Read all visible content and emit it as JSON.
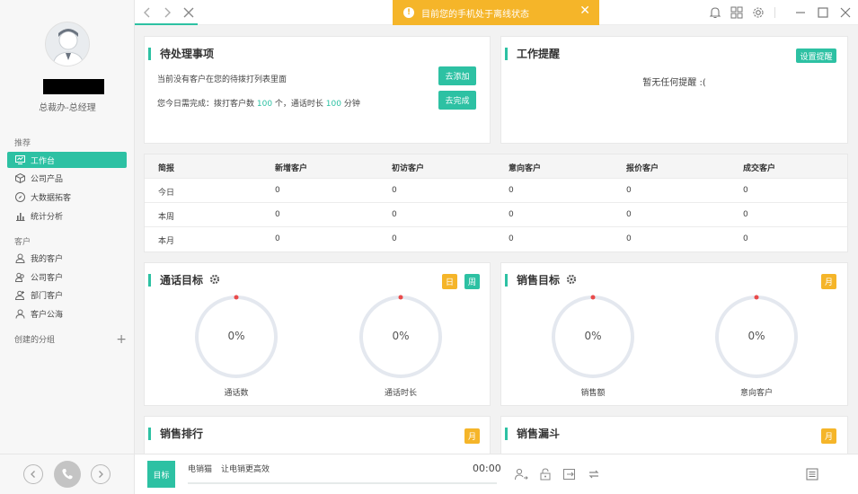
{
  "user": {
    "role": "总裁办-总经理"
  },
  "sidebar": {
    "section_recommend": "推荐",
    "recommend_items": [
      {
        "label": "工作台",
        "icon": "monitor-icon",
        "active": true
      },
      {
        "label": "公司产品",
        "icon": "box-icon"
      },
      {
        "label": "大数据拓客",
        "icon": "compass-icon"
      },
      {
        "label": "统计分析",
        "icon": "bar-chart-icon"
      }
    ],
    "section_customer": "客户",
    "customer_items": [
      {
        "label": "我的客户",
        "icon": "user-icon"
      },
      {
        "label": "公司客户",
        "icon": "users-icon"
      },
      {
        "label": "部门客户",
        "icon": "dept-icon"
      },
      {
        "label": "客户公海",
        "icon": "user-pool-icon"
      }
    ],
    "create_group": "创建的分组"
  },
  "topbar": {
    "offline_message": "目前您的手机处于离线状态",
    "accent": "#2dc1a3",
    "warning_color": "#f5b529"
  },
  "todo": {
    "title": "待处理事项",
    "line1": "当前没有客户在您的待拨打列表里面",
    "add_button": "去添加",
    "line2_prefix": "您今日需完成：拨打客户数 ",
    "calls": "100",
    "line2_mid": " 个，通话时长 ",
    "minutes": "100",
    "line2_suffix": " 分钟",
    "finish_button": "去完成"
  },
  "reminder": {
    "title": "工作提醒",
    "settings_button": "设置提醒",
    "empty_text": "暂无任何提醒 :("
  },
  "stats_table": {
    "headers": [
      "简报",
      "新增客户",
      "初访客户",
      "意向客户",
      "报价客户",
      "成交客户"
    ],
    "rows": [
      [
        "今日",
        "0",
        "0",
        "0",
        "0",
        "0"
      ],
      [
        "本周",
        "0",
        "0",
        "0",
        "0",
        "0"
      ],
      [
        "本月",
        "0",
        "0",
        "0",
        "0",
        "0"
      ]
    ]
  },
  "call_goal": {
    "title": "通话目标",
    "badge_day": "日",
    "badge_week": "周",
    "gauges": [
      {
        "value": "0%",
        "label": "通话数"
      },
      {
        "value": "0%",
        "label": "通话时长"
      }
    ]
  },
  "sales_goal": {
    "title": "销售目标",
    "badge_month": "月",
    "gauges": [
      {
        "value": "0%",
        "label": "销售额"
      },
      {
        "value": "0%",
        "label": "意向客户"
      }
    ]
  },
  "sales_rank": {
    "title": "销售排行",
    "badge_month": "月"
  },
  "sales_funnel": {
    "title": "销售漏斗",
    "badge_month": "月"
  },
  "call_bar": {
    "goal_button": "目标",
    "app_name": "电销猫",
    "slogan": "让电销更高效",
    "timer": "00:00"
  }
}
